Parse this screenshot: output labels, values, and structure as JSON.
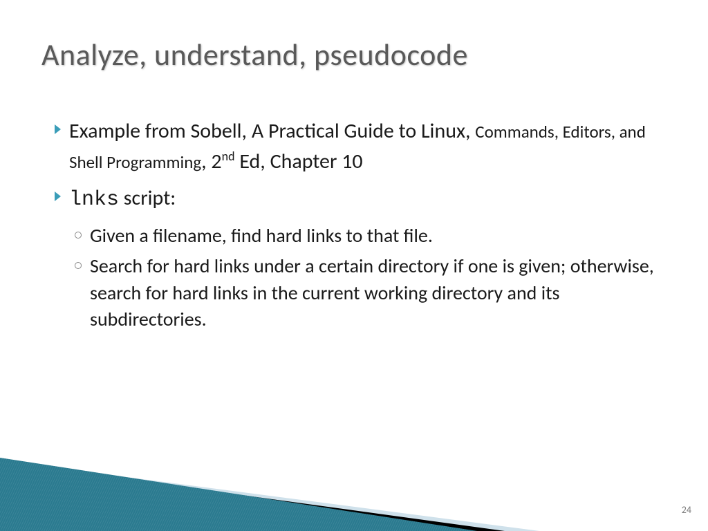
{
  "title": "Analyze, understand, pseudocode",
  "bullets": [
    {
      "main_pre": "Example from Sobell, A Practical Guide to Linux, ",
      "subtitle": "Commands, Editors, and Shell Programming",
      "main_mid": ", 2",
      "sup": "nd",
      "main_post": " Ed, Chapter 10"
    },
    {
      "code": "lnks",
      "after_code": " script:"
    }
  ],
  "sub_bullets": [
    "Given a filename, find hard links to that file.",
    "Search for hard links under a certain directory if one is given; otherwise, search for hard links in the current working directory and its subdirectories."
  ],
  "page_number": "24"
}
